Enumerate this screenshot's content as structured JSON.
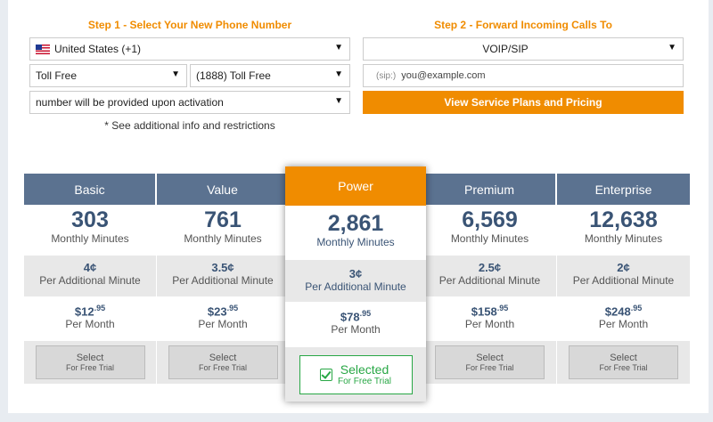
{
  "step1": {
    "title": "Step 1 - Select Your New Phone Number",
    "country": "United States (+1)",
    "number_type": "Toll Free",
    "prefix": "(1888) Toll Free",
    "number": "number will be provided upon activation",
    "note": "* See additional info and restrictions"
  },
  "step2": {
    "title": "Step 2 - Forward Incoming Calls To",
    "forward_type": "VOIP/SIP",
    "sip_prefix": "(sip:)",
    "sip_placeholder": "you@example.com",
    "plans_button": "View Service Plans and Pricing"
  },
  "plans": [
    {
      "name": "Basic",
      "minutes": "303",
      "minutes_label": "Monthly Minutes",
      "per_min": "4¢",
      "per_min_label": "Per Additional Minute",
      "price_dollars": "$12",
      "price_cents": ".95",
      "price_label": "Per Month",
      "select": "Select",
      "trial": "For Free Trial"
    },
    {
      "name": "Value",
      "minutes": "761",
      "minutes_label": "Monthly Minutes",
      "per_min": "3.5¢",
      "per_min_label": "Per Additional Minute",
      "price_dollars": "$23",
      "price_cents": ".95",
      "price_label": "Per Month",
      "select": "Select",
      "trial": "For Free Trial"
    },
    {
      "name": "Power",
      "minutes": "2,861",
      "minutes_label": "Monthly Minutes",
      "per_min": "3¢",
      "per_min_label": "Per Additional Minute",
      "price_dollars": "$78",
      "price_cents": ".95",
      "price_label": "Per Month",
      "select": "Selected",
      "trial": "For Free Trial"
    },
    {
      "name": "Premium",
      "minutes": "6,569",
      "minutes_label": "Monthly Minutes",
      "per_min": "2.5¢",
      "per_min_label": "Per Additional Minute",
      "price_dollars": "$158",
      "price_cents": ".95",
      "price_label": "Per Month",
      "select": "Select",
      "trial": "For Free Trial"
    },
    {
      "name": "Enterprise",
      "minutes": "12,638",
      "minutes_label": "Monthly Minutes",
      "per_min": "2¢",
      "per_min_label": "Per Additional Minute",
      "price_dollars": "$248",
      "price_cents": ".95",
      "price_label": "Per Month",
      "select": "Select",
      "trial": "For Free Trial"
    }
  ],
  "colors": {
    "accent": "#f08c00",
    "header": "#5b7290",
    "selected": "#28a745"
  },
  "icons": {
    "dropdown": "caret-down-icon",
    "flag": "us-flag-icon",
    "check": "checkbox-checked-icon"
  }
}
